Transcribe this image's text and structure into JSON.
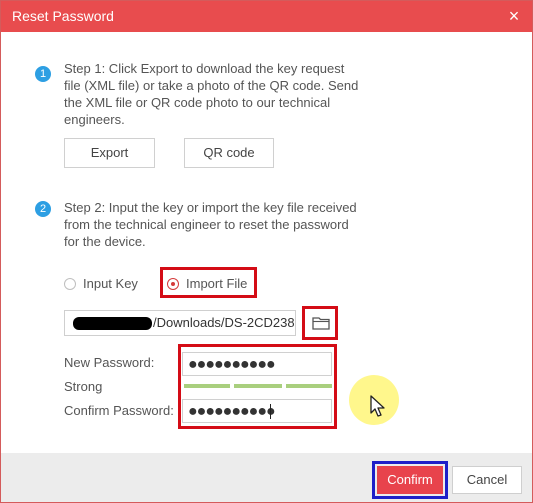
{
  "dialog": {
    "title": "Reset Password",
    "close_glyph": "×"
  },
  "step1": {
    "number": "1",
    "lines": [
      "Step 1: Click Export to download the key request",
      "file (XML file) or take a photo of the QR code. Send",
      "the XML file or QR code photo to our technical",
      "engineers."
    ],
    "export_label": "Export",
    "qr_label": "QR code"
  },
  "step2": {
    "number": "2",
    "lines": [
      "Step 2: Input the key or import the key file received",
      "from the technical engineer to reset the password",
      "for the device."
    ],
    "option_input_key": "Input Key",
    "option_import_file": "Import File",
    "selected_option": "Import File",
    "file_path": "/Downloads/DS-2CD238",
    "browse_icon": "folder-icon"
  },
  "password": {
    "new_label": "New Password:",
    "new_value": "●●●●●●●●●●",
    "strength_label": "Strong",
    "confirm_label": "Confirm Password:",
    "confirm_value": "●●●●●●●●●●"
  },
  "footer": {
    "confirm_label": "Confirm",
    "cancel_label": "Cancel"
  },
  "colors": {
    "titlebar": "#e84c4e",
    "accent_red": "#d40c16",
    "highlight_blue": "#1f1fc8",
    "step_badge": "#2d9fe3",
    "strength_bar": "#a9cf7e"
  }
}
